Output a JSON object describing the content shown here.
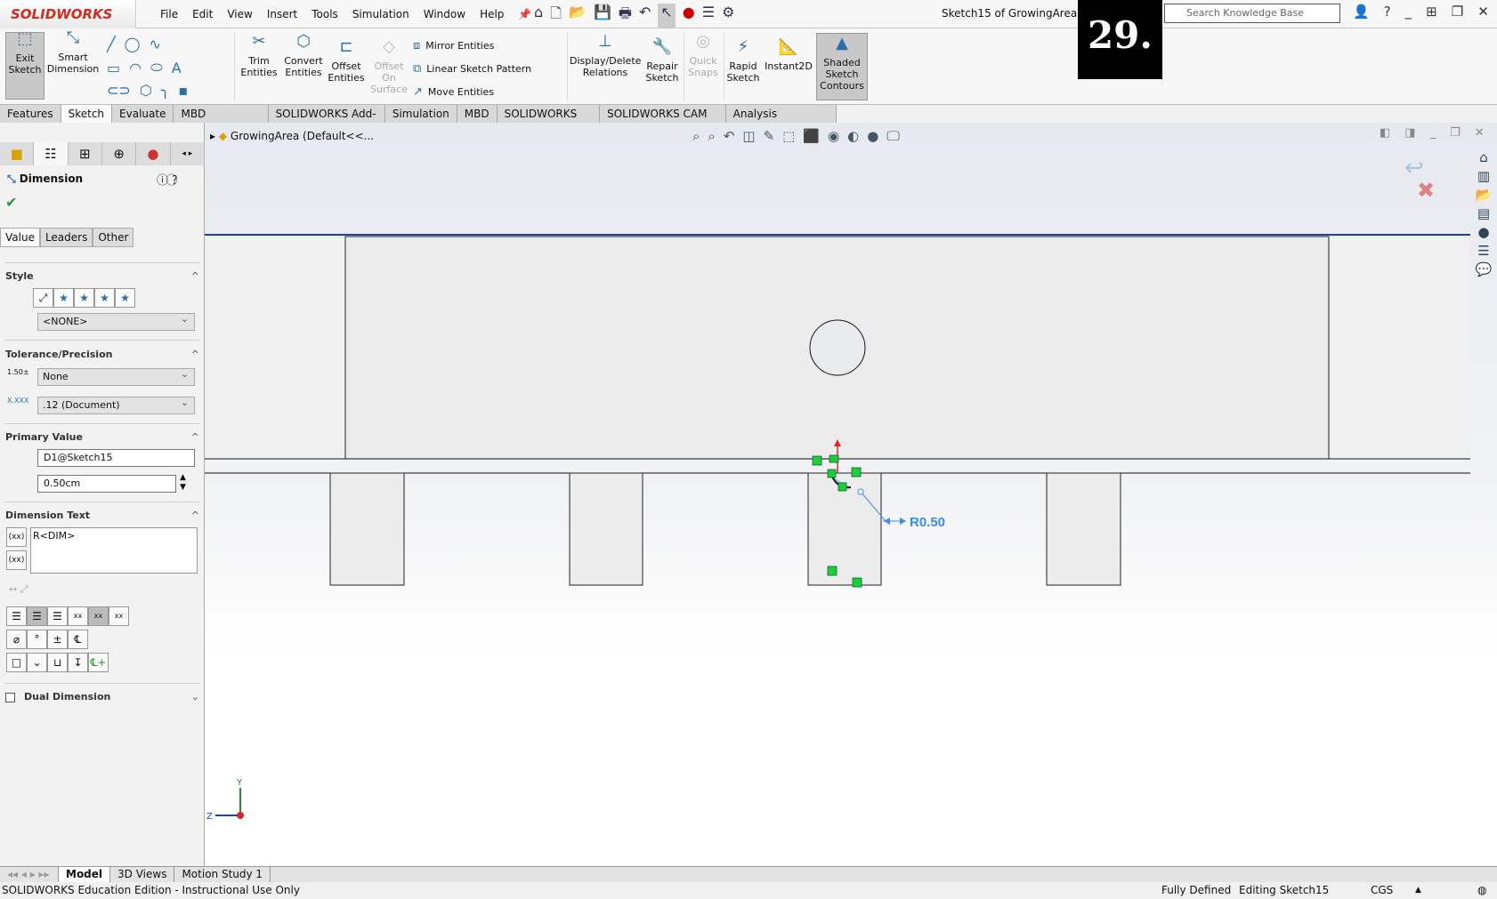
{
  "app": {
    "logo": "SOLIDWORKS",
    "document_title": "Sketch15 of GrowingArea *",
    "overlay_label": "29."
  },
  "menu": [
    "File",
    "Edit",
    "View",
    "Insert",
    "Tools",
    "Simulation",
    "Window",
    "Help"
  ],
  "search": {
    "placeholder": "Search Knowledge Base"
  },
  "ribbon": {
    "exit_sketch": "Exit Sketch",
    "smart_dimension": "Smart Dimension",
    "trim": "Trim Entities",
    "convert": "Convert Entities",
    "offset": "Offset Entities",
    "offset_surface": "Offset On Surface",
    "mirror": "Mirror Entities",
    "linear_pattern": "Linear Sketch Pattern",
    "move": "Move Entities",
    "display_relations": "Display/Delete Relations",
    "repair": "Repair Sketch",
    "quick_snaps": "Quick Snaps",
    "rapid_sketch": "Rapid Sketch",
    "instant2d": "Instant2D",
    "shaded_contours": "Shaded Sketch Contours"
  },
  "command_tabs": [
    "Features",
    "Sketch",
    "Evaluate",
    "MBD Dimensions",
    "SOLIDWORKS Add-Ins",
    "Simulation",
    "MBD",
    "SOLIDWORKS CAM",
    "SOLIDWORKS CAM TBM",
    "Analysis Preparation"
  ],
  "active_command_tab": "Sketch",
  "tree": {
    "root": "GrowingArea  (Default<<..."
  },
  "panel": {
    "title": "Dimension",
    "tabs": [
      "Value",
      "Leaders",
      "Other"
    ],
    "style": {
      "header": "Style",
      "selected": "<NONE>"
    },
    "tolerance": {
      "header": "Tolerance/Precision",
      "tolerance_type": "None",
      "precision": ".12 (Document)"
    },
    "primary": {
      "header": "Primary Value",
      "name": "D1@Sketch15",
      "value": "0.50cm"
    },
    "dimtext": {
      "header": "Dimension Text",
      "text": "R<DIM>"
    },
    "dual": {
      "label": "Dual Dimension",
      "checked": false
    }
  },
  "viewport": {
    "dimension_label": "R0.50",
    "triad": {
      "y": "Y",
      "z": "Z"
    },
    "dimension_color": "#3b8fe8",
    "sketch_color": "#000000",
    "relation_color": "#22cc33"
  },
  "bottom_tabs": [
    "Model",
    "3D Views",
    "Motion Study 1"
  ],
  "status": {
    "edition": "SOLIDWORKS Education Edition - Instructional Use Only",
    "state": "Fully Defined",
    "editing": "Editing Sketch15",
    "units": "CGS"
  }
}
